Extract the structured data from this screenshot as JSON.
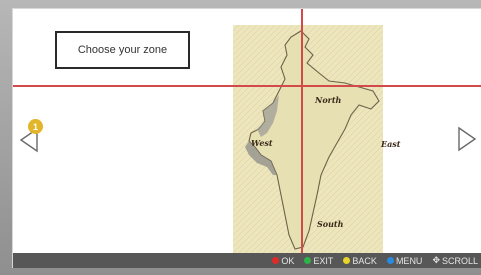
{
  "header": {
    "zone_prompt": "Choose your zone"
  },
  "badge": {
    "count": "1"
  },
  "map": {
    "regions": {
      "north": "North",
      "west": "West",
      "east": "East",
      "south": "South"
    }
  },
  "navigation": {
    "left_icon": "triangle-left-icon",
    "right_icon": "triangle-right-icon"
  },
  "footer": {
    "items": [
      {
        "label": "OK",
        "color": "#e02a2a"
      },
      {
        "label": "EXIT",
        "color": "#2fb24a"
      },
      {
        "label": "BACK",
        "color": "#e8d52a"
      },
      {
        "label": "MENU",
        "color": "#2a8ae0"
      },
      {
        "label": "SCROLL",
        "icon": "four-way-arrow-icon"
      }
    ]
  },
  "colors": {
    "crosshair": "#d24a4a",
    "footer_bg": "#575757",
    "badge": "#e3b52a"
  }
}
